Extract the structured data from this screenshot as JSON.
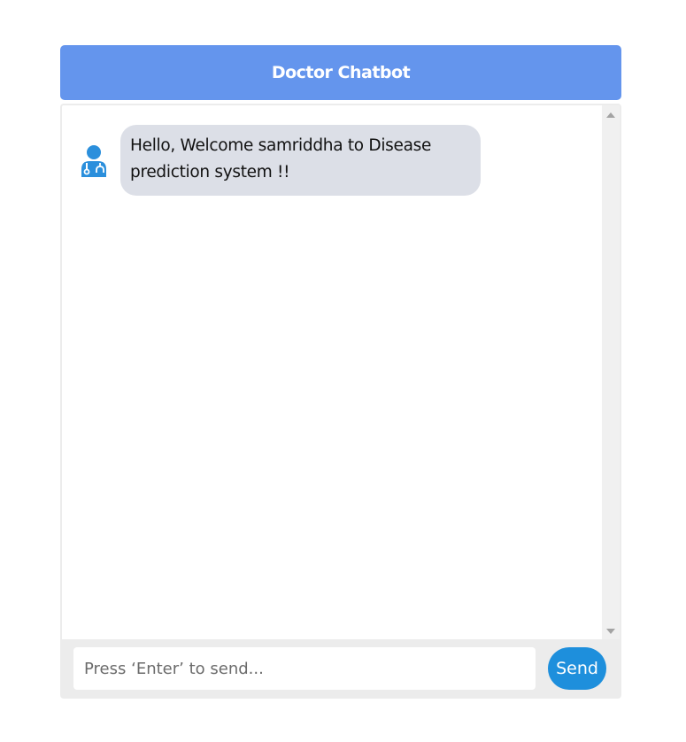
{
  "header": {
    "title": "Doctor Chatbot"
  },
  "messages": [
    {
      "sender_icon": "doctor-icon",
      "text": "Hello, Welcome samriddha to Disease prediction system !!"
    }
  ],
  "composer": {
    "placeholder": "Press ‘Enter’ to send...",
    "send_label": "Send"
  },
  "colors": {
    "header_background": "#6495ed",
    "bubble_background": "#dcdfe7",
    "send_button": "#1e8fdc",
    "doctor_icon": "#2b8fdc"
  }
}
